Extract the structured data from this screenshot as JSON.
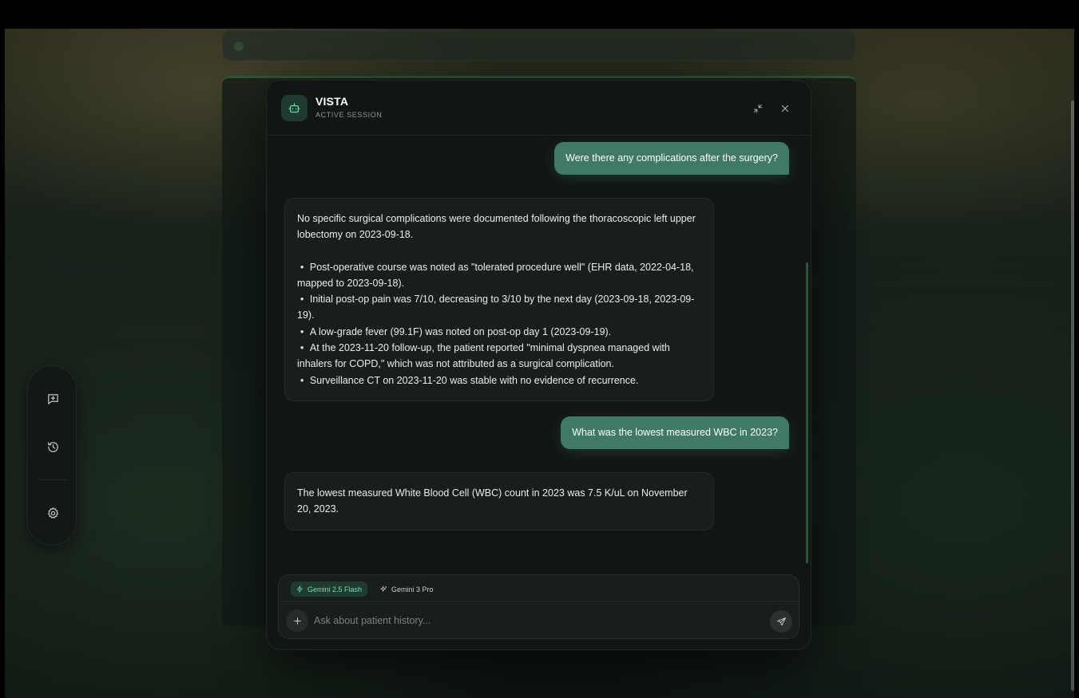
{
  "chat": {
    "title": "VISTA",
    "subtitle": "ACTIVE SESSION",
    "messages": [
      {
        "role": "user",
        "text": "Were there any complications after the surgery?"
      },
      {
        "role": "assistant",
        "intro": "No specific surgical complications were documented following the thoracoscopic left upper lobectomy on 2023-09-18.",
        "bullets": [
          "Post-operative course was noted as \"tolerated procedure well\" (EHR data, 2022-04-18, mapped to 2023-09-18).",
          "Initial post-op pain was 7/10, decreasing to 3/10 by the next day (2023-09-18, 2023-09-19).",
          "A low-grade fever (99.1F) was noted on post-op day 1 (2023-09-19).",
          "At the 2023-11-20 follow-up, the patient reported \"minimal dyspnea managed with inhalers for COPD,\" which was not attributed as a surgical complication.",
          "Surveillance CT on 2023-11-20 was stable with no evidence of recurrence."
        ]
      },
      {
        "role": "user",
        "text": "What was the lowest measured WBC in 2023?"
      },
      {
        "role": "assistant",
        "text": "The lowest measured White Blood Cell (WBC) count in 2023 was 7.5 K/uL on November 20, 2023."
      }
    ]
  },
  "composer": {
    "models": [
      {
        "label": "Gemini 2.5 Flash",
        "active": true,
        "icon": "lightning-icon"
      },
      {
        "label": "Gemini 3 Pro",
        "active": false,
        "icon": "sparkles-icon"
      }
    ],
    "placeholder": "Ask about patient history...",
    "value": ""
  },
  "dock": {
    "items": [
      {
        "name": "new-chat",
        "icon": "message-plus-icon"
      },
      {
        "name": "history",
        "icon": "history-icon"
      },
      {
        "name": "settings",
        "icon": "gear-icon"
      }
    ]
  },
  "colors": {
    "accent": "#3e7a66",
    "accent_text": "#6fe3a7",
    "panel": "#111615",
    "bubble_bot": "#181e1c"
  }
}
